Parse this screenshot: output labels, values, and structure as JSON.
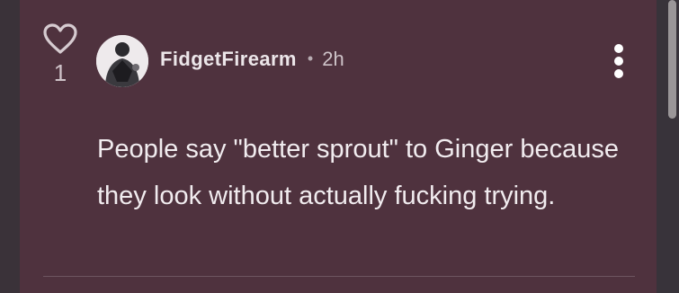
{
  "comment": {
    "author": "FidgetFirearm",
    "separator": "•",
    "timestamp": "2h",
    "body": "People say \"better sprout\" to Ginger because they look without actually fucking trying.",
    "like_count": "1",
    "icons": {
      "like": "heart-outline-icon",
      "more": "vertical-ellipsis-icon"
    }
  },
  "colors": {
    "card_background": "#4f323e",
    "text_primary": "#f1ecef",
    "text_secondary": "#cdc2c7"
  }
}
